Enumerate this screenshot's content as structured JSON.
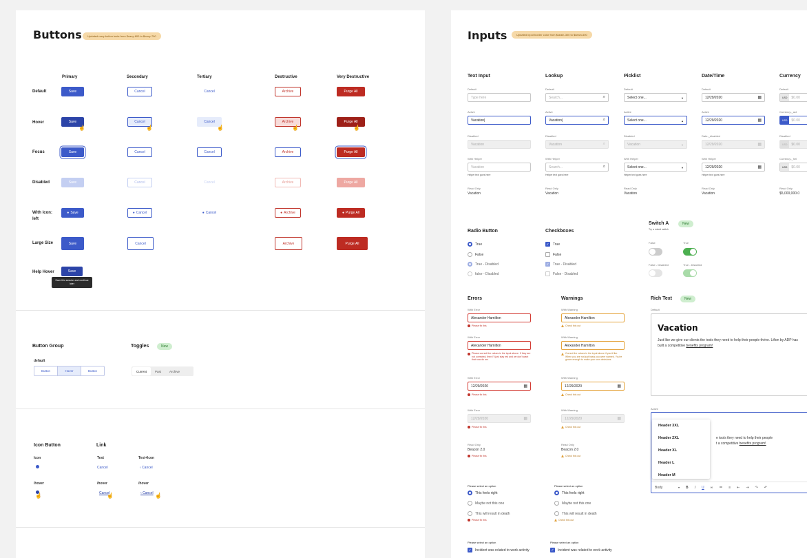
{
  "buttons": {
    "title": "Buttons",
    "badge": "Updated navy button texts from $navy-600 to $navy-700",
    "columns": [
      "Primary",
      "Secondary",
      "Tertiary",
      "Destructive",
      "Very Destructive"
    ],
    "rows": [
      "Default",
      "Hover",
      "Focus",
      "Disabled",
      "With Icon: left",
      "Large Size",
      "Help Hover"
    ],
    "labels": {
      "primary": "Save",
      "secondary": "Cancel",
      "tertiary": "Cancel",
      "destructive": "Archive",
      "very": "Purge All"
    },
    "tooltip": "Save this session and continue later",
    "button_group": {
      "title": "Button Group",
      "sub": "default",
      "items": [
        "Button",
        "Hover",
        "Button"
      ]
    },
    "toggles": {
      "title": "Toggles",
      "badge": "New",
      "items": [
        "Current",
        "Past",
        "Archive"
      ]
    },
    "icon_button": {
      "title": "Icon Button",
      "icon": "Icon",
      "hover": "/hover"
    },
    "link": {
      "title": "Link",
      "text": "Text",
      "text_icon": "Text+Icon",
      "cancel": "Cancel",
      "hover": "/hover"
    }
  },
  "inputs": {
    "title": "Inputs",
    "badge": "Updated input border color from $sealn-300 to $sealn-500",
    "columns": {
      "text": {
        "title": "Text Input",
        "default_label": "Default",
        "placeholder": "Type here",
        "active_label": "Active",
        "active_value": "Vacation|",
        "disabled_label": "Disabled",
        "disabled_value": "Vacation",
        "helper_label": "With Helper",
        "helper_value": "Vacation",
        "helper_text": "Helper text goes here",
        "readonly_label": "Read Only",
        "readonly_value": "Vacation"
      },
      "lookup": {
        "title": "Lookup",
        "default_label": "Default",
        "placeholder": "Search...",
        "active_label": "Active",
        "active_value": "Vacation|",
        "disabled_label": "Disabled",
        "disabled_value": "Vacation",
        "helper_label": "With Helper",
        "helper_value": "Search...",
        "helper_text": "Helper text goes here",
        "readonly_label": "Read Only",
        "readonly_value": "Vacation"
      },
      "picklist": {
        "title": "Picklist",
        "default_label": "Default",
        "value": "Select one...",
        "active_label": "Active",
        "active_value": "Select one...",
        "disabled_label": "Disabled",
        "disabled_value": "Vacation",
        "helper_label": "With Helper",
        "helper_value": "Select one...",
        "helper_text": "Helper text goes here",
        "readonly_label": "Read Only",
        "readonly_value": "Vacation"
      },
      "datetime": {
        "title": "Date/Time",
        "default_label": "Default",
        "value": "12/29/2020",
        "active_label": "Active",
        "active_value": "12/29/2020",
        "disabled_label": "Date-_disabled",
        "disabled_value": "12/29/2020",
        "helper_label": "With Helper",
        "helper_value": "12/29/2020",
        "helper_text": "Helper text goes here",
        "readonly_label": "Read Only",
        "readonly_value": "Vacation"
      },
      "currency": {
        "title": "Currency",
        "default_label": "Default",
        "prefix": "USD",
        "value": "$0.00",
        "active_label": "Currency-_act",
        "disabled_label": "Disabled",
        "helper_label": "Currency-_hel",
        "readonly_label": "Read Only",
        "readonly_value": "$5,000,000.0"
      }
    },
    "radio": {
      "title": "Radio Button",
      "items": [
        "True",
        "False",
        "True - Disabled",
        "false - Disabled"
      ]
    },
    "checkbox": {
      "title": "Checkboxes",
      "items": [
        "True",
        "False",
        "True - Disabled",
        "False - Disabled"
      ]
    },
    "switch": {
      "title": "Switch A",
      "badge": "New",
      "sub": "Try a mixed switch",
      "false": "False",
      "true": "True",
      "false_dis": "False - Disabled",
      "true_dis": "True - Disabled"
    },
    "errors": {
      "title": "Errors",
      "label": "With Error",
      "name": "Alexander Hamilton",
      "msg": "Please fix this",
      "long_msg": "Please correct the values in the input above. If they are not corrected, then I'll just stay red and we don't want that now do we.",
      "date": "12/29/2020",
      "readonly_label": "Read Only",
      "readonly_value": "Beacon 2.0"
    },
    "warnings": {
      "title": "Warnings",
      "label": "With Warning",
      "name": "Alexander Hamilton",
      "msg": "Check this out",
      "long_msg": "Correct the values in the input above if you'd like. When you are not just basis you were warned. You're grown enough to make your own decisions.",
      "date": "12/29/2020",
      "readonly_label": "Read Only",
      "readonly_value": "Beacon 2.0"
    },
    "richtext": {
      "title": "Rich Text",
      "badge": "New",
      "default_label": "Default",
      "heading": "Vacation",
      "body": "Just like we give our clients the tools they need to help their people thrive. Lifion by ADP has built a competitive ",
      "link": "benefits program!",
      "active_label": "Active",
      "active_body1": "e tools they need to help their people",
      "active_body2": "t a competitive ",
      "menu": [
        "Header 3XL",
        "Header 2XL",
        "Header XL",
        "Header L",
        "Header M"
      ],
      "style": "Body"
    },
    "option_groups": {
      "prompt": "Please select an option",
      "options": [
        "This feels right",
        "Maybe not this one",
        "This will result in death"
      ],
      "error": "Please fix this",
      "warning": "Check this out"
    },
    "check_group": {
      "prompt": "Please select an option",
      "option": "Incident was related to work activity"
    }
  }
}
